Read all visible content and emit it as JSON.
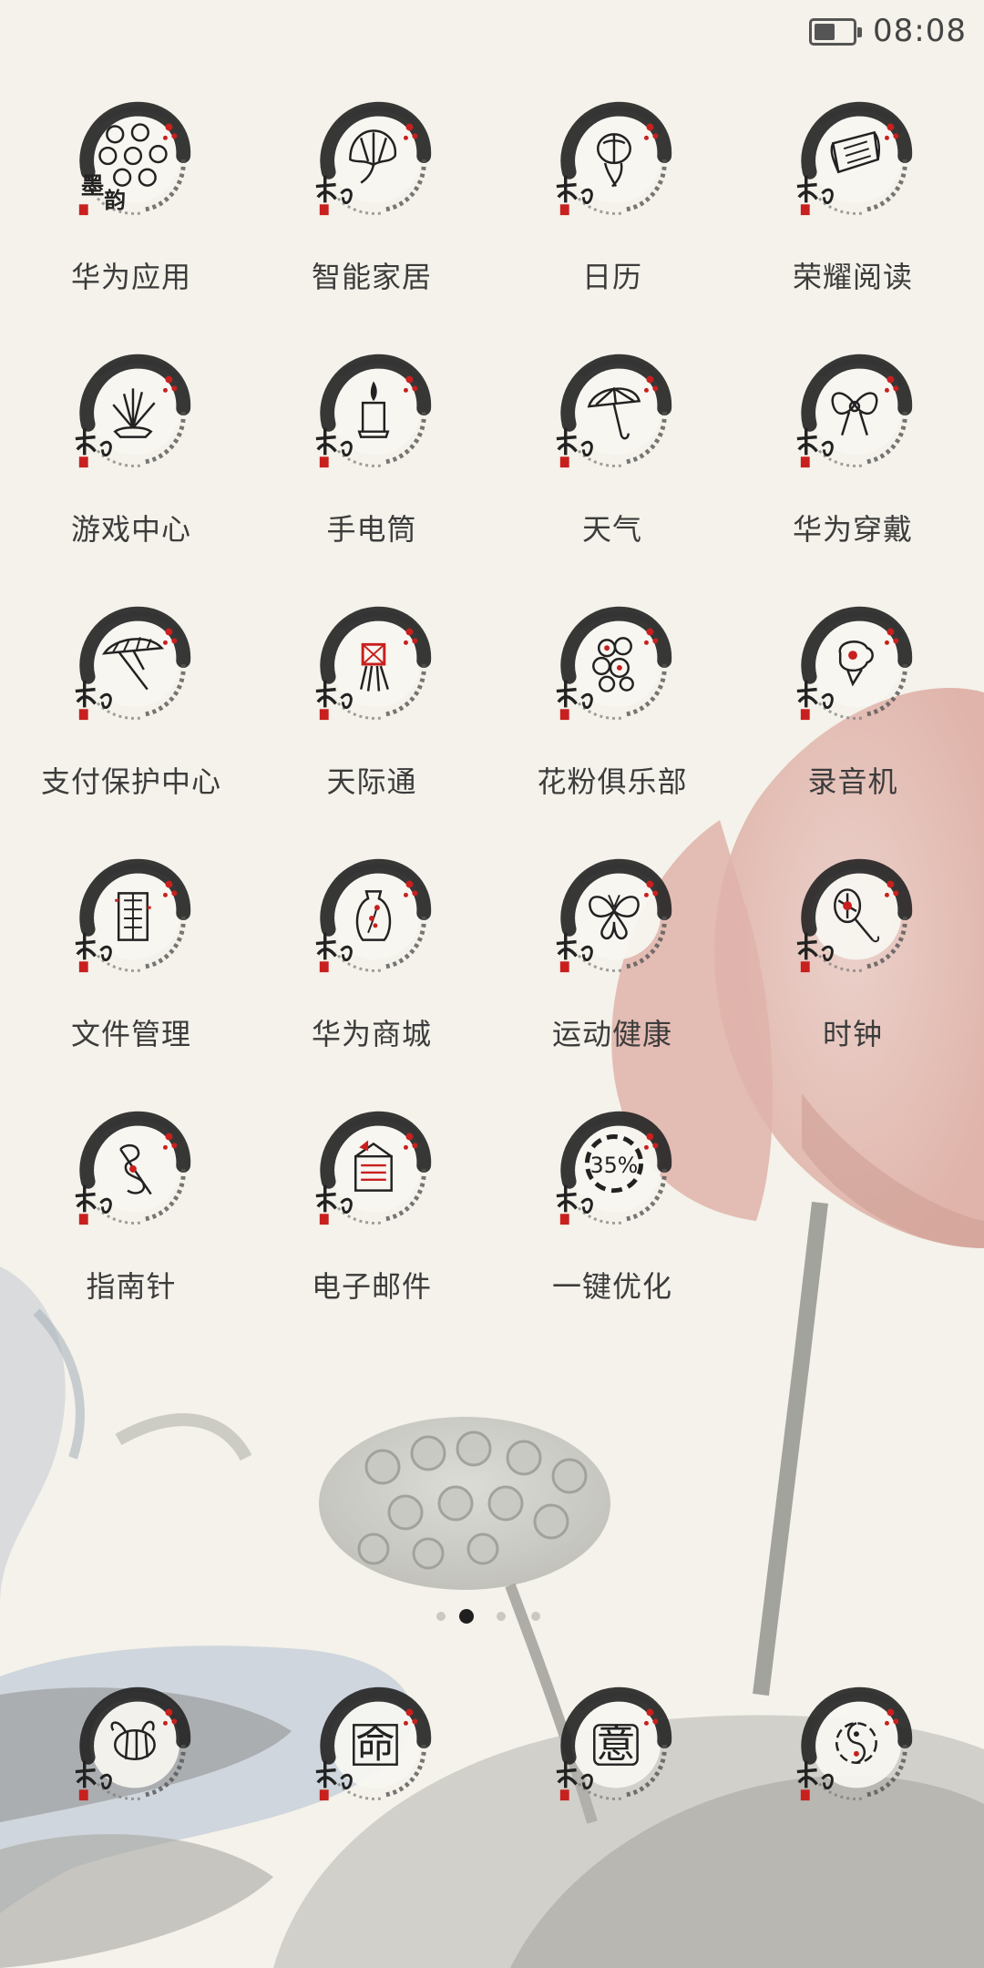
{
  "status_bar": {
    "time": "08:08",
    "battery_level": 0.55
  },
  "apps": [
    {
      "name": "华为应用",
      "icon": "moyun-theme-icon"
    },
    {
      "name": "智能家居",
      "icon": "smart-home-icon"
    },
    {
      "name": "日历",
      "icon": "calendar-icon"
    },
    {
      "name": "荣耀阅读",
      "icon": "reading-scroll-icon"
    },
    {
      "name": "游戏中心",
      "icon": "game-center-icon"
    },
    {
      "name": "手电筒",
      "icon": "flashlight-candle-icon"
    },
    {
      "name": "天气",
      "icon": "weather-umbrella-icon"
    },
    {
      "name": "华为穿戴",
      "icon": "wearable-bow-icon"
    },
    {
      "name": "支付保护中心",
      "icon": "payment-protection-icon"
    },
    {
      "name": "天际通",
      "icon": "skyline-knot-icon"
    },
    {
      "name": "花粉俱乐部",
      "icon": "fan-club-flower-icon"
    },
    {
      "name": "录音机",
      "icon": "recorder-icon"
    },
    {
      "name": "文件管理",
      "icon": "file-manager-icon"
    },
    {
      "name": "华为商城",
      "icon": "store-vase-icon"
    },
    {
      "name": "运动健康",
      "icon": "health-butterfly-icon"
    },
    {
      "name": "时钟",
      "icon": "clock-fan-icon"
    },
    {
      "name": "指南针",
      "icon": "compass-icon"
    },
    {
      "name": "电子邮件",
      "icon": "email-icon"
    },
    {
      "name": "一键优化",
      "icon": "optimizer-icon",
      "percent": "35%"
    }
  ],
  "dock": [
    {
      "icon": "phone-bee-icon"
    },
    {
      "icon": "contacts-ming-icon",
      "glyph": "命"
    },
    {
      "icon": "messages-yi-icon",
      "glyph": "意"
    },
    {
      "icon": "camera-yinyang-icon"
    }
  ],
  "page_indicator": {
    "count": 4,
    "active": 1
  },
  "colors": {
    "background": "#f4f2ea",
    "ink": "#222222",
    "seal_red": "#c8201e",
    "label_text": "#3c3c3c",
    "lotus_pink": "#e2b7ac"
  }
}
